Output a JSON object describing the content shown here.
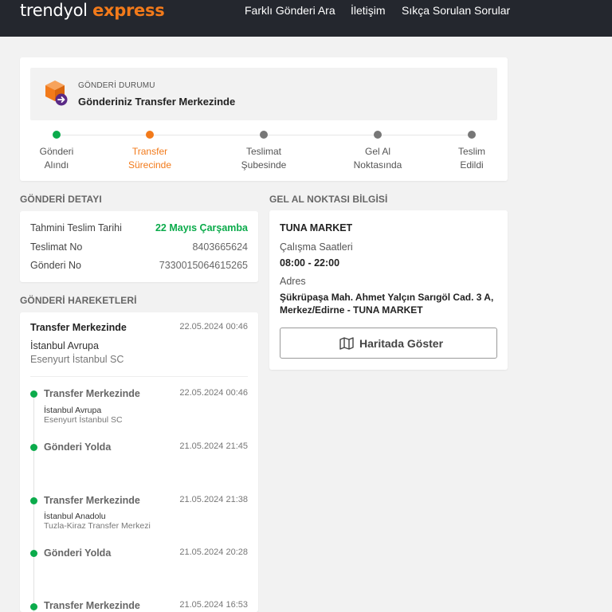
{
  "header": {
    "logo_primary": "trendyol",
    "logo_secondary": "express",
    "nav": [
      "Farklı Gönderi Ara",
      "İletişim",
      "Sıkça Sorulan Sorular"
    ]
  },
  "status": {
    "label": "GÖNDERİ DURUMU",
    "title": "Gönderiniz Transfer Merkezinde",
    "icon": "package-arrow-icon",
    "steps": [
      {
        "line1": "Gönderi",
        "line2": "Alındı",
        "state": "done"
      },
      {
        "line1": "Transfer",
        "line2": "Sürecinde",
        "state": "current"
      },
      {
        "line1": "Teslimat",
        "line2": "Şubesinde",
        "state": "pending"
      },
      {
        "line1": "Gel Al",
        "line2": "Noktasında",
        "state": "pending"
      },
      {
        "line1": "Teslim",
        "line2": "Edildi",
        "state": "pending"
      }
    ]
  },
  "detail": {
    "title": "GÖNDERİ DETAYI",
    "rows": [
      {
        "label": "Tahmini Teslim Tarihi",
        "value": "22 Mayıs Çarşamba"
      },
      {
        "label": "Teslimat No",
        "value": "8403665624"
      },
      {
        "label": "Gönderi No",
        "value": "7330015064615265"
      }
    ]
  },
  "moves": {
    "title": "GÖNDERİ HAREKETLERİ",
    "latest": {
      "title": "Transfer Merkezinde",
      "date": "22.05.2024 00:46",
      "city": "İstanbul Avrupa",
      "hub": "Esenyurt İstanbul SC"
    },
    "events": [
      {
        "title": "Transfer Merkezinde",
        "date": "22.05.2024 00:46",
        "city": "İstanbul Avrupa",
        "hub": "Esenyurt İstanbul SC"
      },
      {
        "title": "Gönderi Yolda",
        "date": "21.05.2024 21:45",
        "city": "",
        "hub": ""
      },
      {
        "title": "Transfer Merkezinde",
        "date": "21.05.2024 21:38",
        "city": "İstanbul Anadolu",
        "hub": "Tuzla-Kiraz Transfer Merkezi"
      },
      {
        "title": "Gönderi Yolda",
        "date": "21.05.2024 20:28",
        "city": "",
        "hub": ""
      },
      {
        "title": "Transfer Merkezinde",
        "date": "21.05.2024 16:53",
        "city": "",
        "hub": ""
      }
    ]
  },
  "pickup": {
    "section_title": "GEL AL NOKTASI BİLGİSİ",
    "name": "TUNA MARKET",
    "hours_label": "Çalışma Saatleri",
    "hours": "08:00 - 22:00",
    "address_label": "Adres",
    "address": "Şükrüpaşa Mah. Ahmet Yalçın Sarıgöl Cad. 3 A, Merkez/Edirne - TUNA MARKET",
    "button_label": "Haritada Göster"
  },
  "colors": {
    "brand": "#f27a1a",
    "done": "#0bab4b",
    "pending": "#777777",
    "header_bg": "#24272e"
  }
}
